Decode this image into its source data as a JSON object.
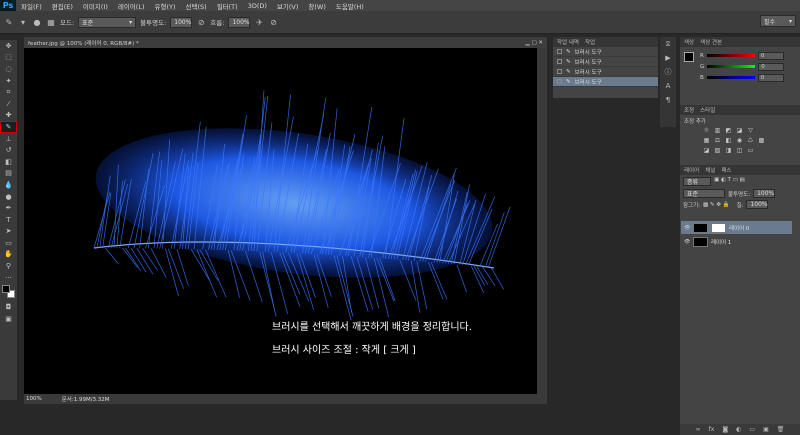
{
  "app": {
    "logo": "Ps"
  },
  "menu": [
    "파일(F)",
    "편집(E)",
    "이미지(I)",
    "레이어(L)",
    "유형(Y)",
    "선택(S)",
    "필터(T)",
    "3D(D)",
    "보기(V)",
    "창(W)",
    "도움말(H)"
  ],
  "options": {
    "mode_label": "모드:",
    "mode_value": "표준",
    "opacity_label": "불투명도:",
    "opacity_value": "100%",
    "flow_label": "흐름:",
    "flow_value": "100%",
    "workspace": "필수"
  },
  "document": {
    "tab_title": "feather.jpg @ 100% (레이어 0, RGB/8#) *",
    "zoom": "100%",
    "doc_size": "문서:1.99M/3.32M",
    "caption_line1": "브러시를 선택해서 깨끗하게 배경을 정리합니다.",
    "caption_line2": "브러시 사이즈 조절 : 작게  [   크게  ]"
  },
  "history": {
    "tabs": [
      "작업 내역",
      "작업"
    ],
    "items": [
      "브러시 도구",
      "브러시 도구",
      "브러시 도구",
      "브러시 도구"
    ]
  },
  "color_panel": {
    "tabs": [
      "색상",
      "색상 견본"
    ],
    "r_label": "R",
    "g_label": "G",
    "b_label": "B",
    "r_value": "0",
    "g_value": "0",
    "b_value": "0"
  },
  "adjust_panel": {
    "tabs": [
      "조정",
      "스타일"
    ],
    "title": "조정 추가"
  },
  "layers_panel": {
    "tabs": [
      "레이어",
      "채널",
      "패스"
    ],
    "kind_label": "종류",
    "blend_value": "표준",
    "opacity_label": "불투명도:",
    "opacity_value": "100%",
    "lock_label": "잠그기:",
    "fill_label": "칠:",
    "fill_value": "100%",
    "layers": [
      "레이어 0",
      "레이어 1"
    ]
  },
  "colors": {
    "accent": "#31a8ff",
    "selected_tool_outline": "#d40000",
    "history_selected": "#6a7b90"
  }
}
